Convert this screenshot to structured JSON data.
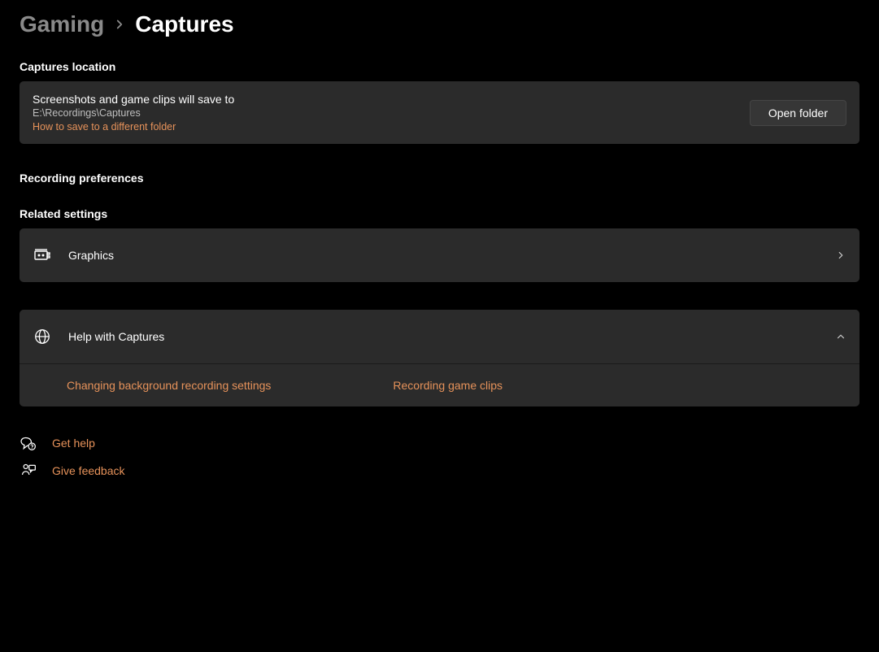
{
  "breadcrumb": {
    "parent": "Gaming",
    "current": "Captures"
  },
  "sections": {
    "captures_location": {
      "heading": "Captures location",
      "title": "Screenshots and game clips will save to",
      "path": "E:\\Recordings\\Captures",
      "help_link": "How to save to a different folder",
      "button": "Open folder"
    },
    "recording_preferences": {
      "heading": "Recording preferences"
    },
    "related_settings": {
      "heading": "Related settings",
      "items": {
        "graphics": {
          "label": "Graphics"
        }
      }
    },
    "help_expander": {
      "label": "Help with Captures",
      "links": {
        "bg_recording": "Changing background recording settings",
        "game_clips": "Recording game clips"
      }
    }
  },
  "bottom_links": {
    "get_help": "Get help",
    "give_feedback": "Give feedback"
  }
}
